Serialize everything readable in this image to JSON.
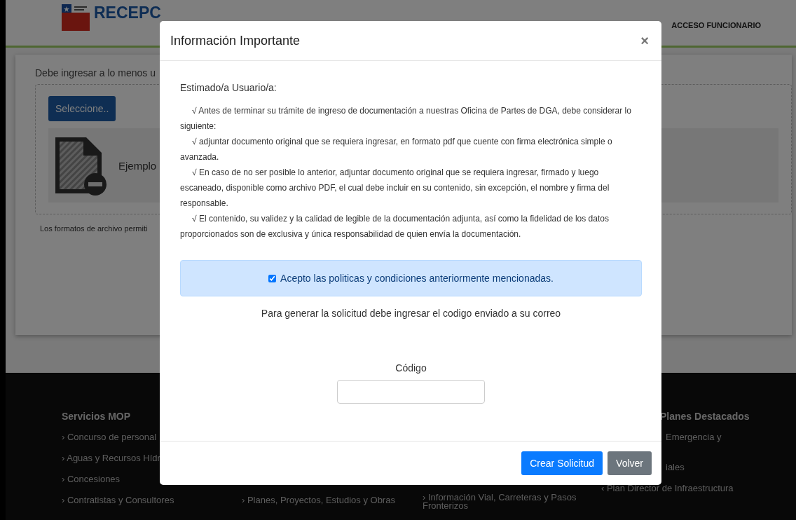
{
  "header": {
    "title": "RECEPC",
    "account_link": "ACCESO FUNCIONARIO"
  },
  "page": {
    "intro": "Debe ingresar a lo menos u",
    "select_button": "Seleccione..",
    "file_name": "Ejemplo",
    "formats_note": "Los formatos de archivo permiti"
  },
  "footer": {
    "columns": [
      {
        "heading": "Servicios MOP",
        "items": [
          "› Concurso de personal",
          "› Aguas y Recursos Hídr",
          "› Concesiones",
          "› Contratistas y Consultores"
        ]
      },
      {
        "items": [
          "› Planes, Proyectos, Estudios y Obras"
        ]
      },
      {
        "items": [
          "› Información Vial, Carreteras y Pasos Fronterizos"
        ]
      },
      {
        "heading": "Planes Destacados",
        "items": [
          "Emergencia y",
          "iales",
          "‹ Plan Director de Infraestructura"
        ]
      }
    ]
  },
  "modal": {
    "title": "Información Importante",
    "close": "×",
    "greeting": "Estimado/a Usuario/a:",
    "bullets": [
      "√  Antes de terminar su trámite de ingreso de documentación a nuestras Oficina de Partes de DGA, debe considerar lo siguiente:",
      "√  adjuntar documento original que se requiera ingresar, en formato pdf que cuente con firma electrónica simple o avanzada.",
      "√  En caso de no ser posible lo anterior, adjuntar documento original que se requiera ingresar, firmado y luego escaneado, disponible como archivo PDF, el cual debe incluir en su contenido, sin excepción, el nombre y firma del responsable.",
      "√  El contenido, su validez y la calidad de legible de la documentación adjunta, así como la fidelidad de los datos proporcionados son de exclusiva y única responsabilidad de quien envía la documentación."
    ],
    "accept": {
      "label": "Acepto las politicas y condiciones anteriormente mencionadas.",
      "checked": true
    },
    "instruction": "Para generar la solicitud debe ingresar el codigo enviado a su correo",
    "code_label": "Código",
    "buttons": [
      {
        "label": "Crear Solicitud",
        "kind": "primary"
      },
      {
        "label": "Volver",
        "kind": "secondary"
      }
    ]
  }
}
